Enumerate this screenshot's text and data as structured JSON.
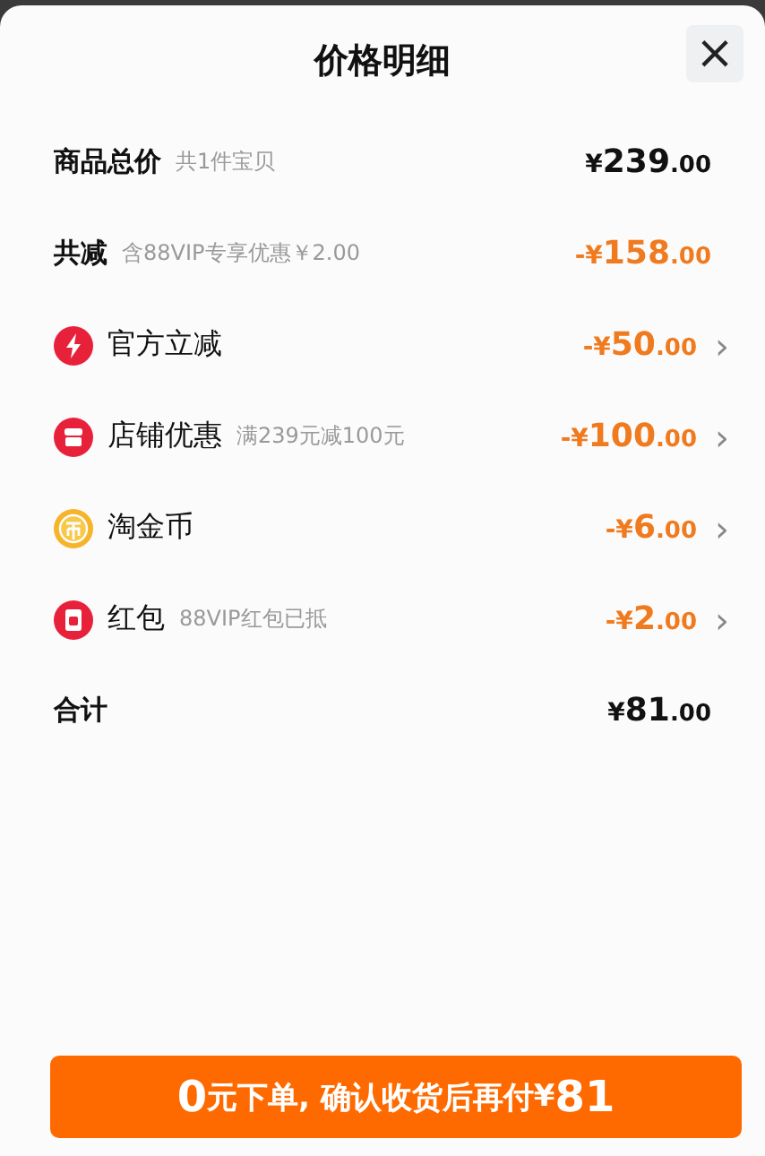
{
  "sheet": {
    "title": "价格明细",
    "close": "×"
  },
  "rows": [
    {
      "kind": "summary",
      "label": "商品总价",
      "note": "共1件宝贝",
      "amount": {
        "prefix": "¥",
        "main": "239",
        "cents": ".00"
      },
      "highlight": false
    },
    {
      "kind": "summary",
      "label": "共减",
      "note": "含88VIP专享优惠￥2.00",
      "amount": {
        "prefix": "-¥",
        "main": "158",
        "cents": ".00"
      },
      "highlight": true
    },
    {
      "kind": "discount",
      "label": "官方立减",
      "amount": {
        "prefix": "-¥",
        "main": "50",
        "cents": ".00"
      },
      "highlight": true,
      "chevron": "›"
    },
    {
      "kind": "discount",
      "label": "店铺优惠",
      "note": "满239元减100元",
      "amount": {
        "prefix": "-¥",
        "main": "100",
        "cents": ".00"
      },
      "highlight": true,
      "chevron": "›"
    },
    {
      "kind": "discount",
      "label": "淘金币",
      "amount": {
        "prefix": "-¥",
        "main": "6",
        "cents": ".00"
      },
      "highlight": true,
      "chevron": "›"
    },
    {
      "kind": "discount",
      "label": "红包",
      "note": "88VIP红包已抵",
      "amount": {
        "prefix": "-¥",
        "main": "2",
        "cents": ".00"
      },
      "highlight": true,
      "chevron": "›"
    },
    {
      "kind": "total",
      "label": "合计",
      "amount": {
        "prefix": "¥",
        "main": "81",
        "cents": ".00"
      },
      "highlight": false
    }
  ],
  "submit": {
    "segments": [
      {
        "text": "0",
        "emphasis": true
      },
      {
        "text": "元下单, 确认收货后再付 ",
        "emphasis": false
      },
      {
        "text": "¥",
        "emphasis": false
      },
      {
        "text": "81",
        "emphasis": true
      }
    ]
  }
}
